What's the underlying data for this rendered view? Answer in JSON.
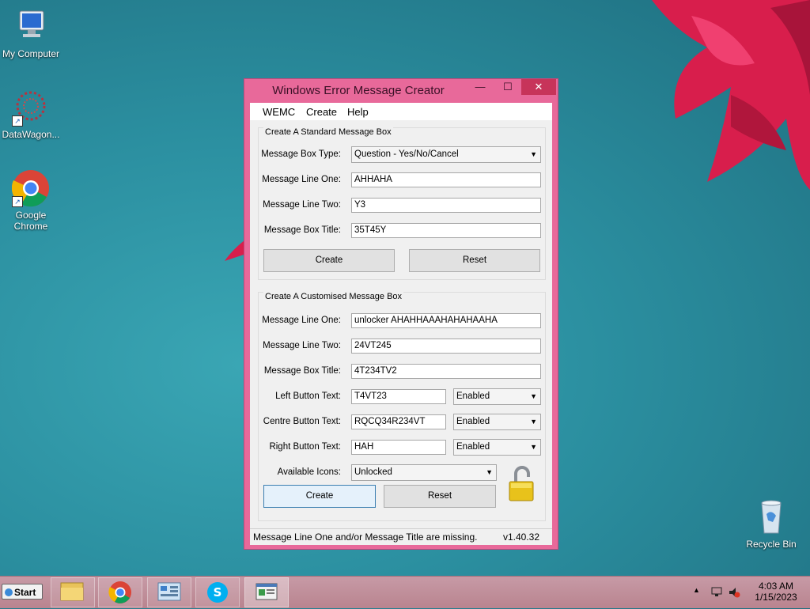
{
  "desktop": {
    "icons": [
      {
        "label": "My Computer",
        "icon": "computer-icon"
      },
      {
        "label": "DataWagon...",
        "icon": "datawagon-icon"
      },
      {
        "label": "Google Chrome",
        "icon": "chrome-icon"
      },
      {
        "label": "Recycle Bin",
        "icon": "recycle-bin-icon"
      }
    ]
  },
  "window": {
    "title": "Windows Error Message Creator",
    "controls": {
      "minimize": "—",
      "maximize": "☐",
      "close": "✕"
    },
    "menu": [
      "WEMC",
      "Create",
      "Help"
    ],
    "standard": {
      "group_label": "Create A Standard Message Box",
      "type_label": "Message Box Type:",
      "type_value": "Question - Yes/No/Cancel",
      "line_one_label": "Message Line One:",
      "line_one_value": "AHHAHA",
      "line_two_label": "Message Line Two:",
      "line_two_value": "Y3",
      "title_label": "Message Box Title:",
      "title_value": "35T45Y",
      "create_label": "Create",
      "reset_label": "Reset"
    },
    "custom": {
      "group_label": "Create A Customised Message Box",
      "line_one_label": "Message Line One:",
      "line_one_value": "unlocker AHAHHAAAHAHAHAAHA",
      "line_two_label": "Message Line Two:",
      "line_two_value": "24VT245",
      "title_label": "Message Box Title:",
      "title_value": "4T234TV2",
      "left_label": "Left Button Text:",
      "left_value": "T4VT23",
      "left_state": "Enabled",
      "centre_label": "Centre Button Text:",
      "centre_value": "RQCQ34R234VT",
      "centre_state": "Enabled",
      "right_label": "Right Button Text:",
      "right_value": "HAH",
      "right_state": "Enabled",
      "icons_label": "Available Icons:",
      "icons_value": "Unlocked",
      "create_label": "Create",
      "reset_label": "Reset"
    },
    "status": {
      "message": "Message Line One and/or Message Title are missing.",
      "version": "v1.40.32"
    }
  },
  "taskbar": {
    "start_label": "Start",
    "time": "4:03 AM",
    "date": "1/15/2023"
  },
  "colors": {
    "window_frame": "#e8699a",
    "close_button": "#c7345a",
    "desktop": "#2b8fa0"
  }
}
